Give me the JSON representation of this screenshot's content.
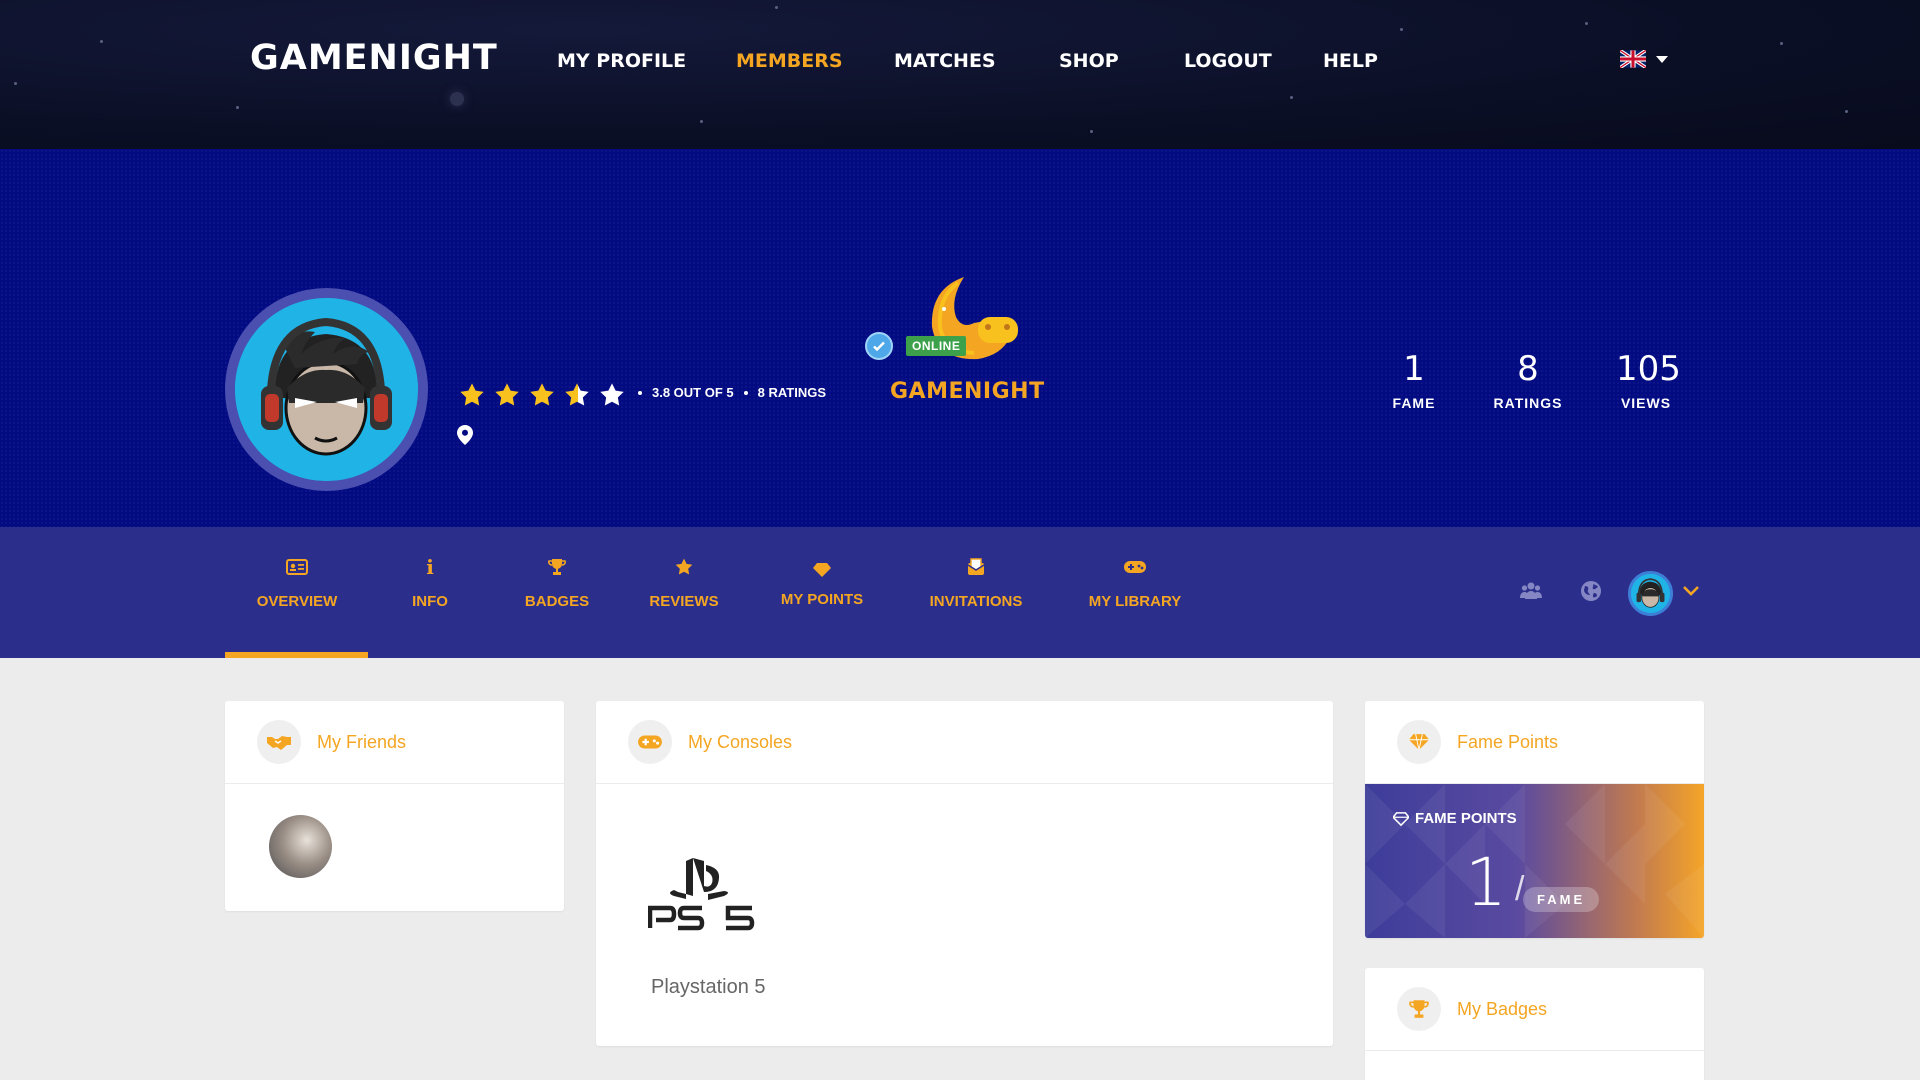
{
  "colors": {
    "accent": "#f4a622",
    "hero_bg": "#020b82",
    "tabbar_bg": "#2c2e8c",
    "online": "#3ca14a",
    "topbar_bg": "#0b0f26"
  },
  "header": {
    "logo": "GAMENIGHT",
    "nav": [
      {
        "label": "MY PROFILE",
        "active": false
      },
      {
        "label": "MEMBERS",
        "active": true
      },
      {
        "label": "MATCHES",
        "active": false
      },
      {
        "label": "SHOP",
        "active": false
      },
      {
        "label": "LOGOUT",
        "active": false
      },
      {
        "label": "HELP",
        "active": false
      }
    ],
    "language_icon": "uk-flag-icon"
  },
  "profile": {
    "rating_value": 3.8,
    "rating_text": "3.8 OUT OF 5",
    "ratings_count_text": "8 RATINGS",
    "status": "ONLINE",
    "brand": "GAMENIGHT",
    "stats": [
      {
        "value": "1",
        "label": "FAME"
      },
      {
        "value": "8",
        "label": "RATINGS"
      },
      {
        "value": "105",
        "label": "VIEWS"
      }
    ]
  },
  "tabs": [
    {
      "label": "OVERVIEW",
      "icon": "id-card-icon",
      "active": true
    },
    {
      "label": "INFO",
      "icon": "info-icon",
      "active": false
    },
    {
      "label": "BADGES",
      "icon": "trophy-icon",
      "active": false
    },
    {
      "label": "REVIEWS",
      "icon": "star-icon",
      "active": false
    },
    {
      "label": "MY POINTS",
      "icon": "diamond-icon",
      "active": false
    },
    {
      "label": "INVITATIONS",
      "icon": "envelope-icon",
      "active": false
    },
    {
      "label": "MY LIBRARY",
      "icon": "gamepad-icon",
      "active": false
    }
  ],
  "cards": {
    "friends": {
      "title": "My Friends",
      "icon": "handshake-icon"
    },
    "consoles": {
      "title": "My Consoles",
      "icon": "gamepad-icon",
      "items": [
        {
          "logo": "PS5",
          "name": "Playstation 5"
        }
      ]
    },
    "fame": {
      "title": "Fame Points",
      "icon": "diamond-icon",
      "banner_label": "FAME POINTS",
      "value": "1",
      "unit": "FAME"
    },
    "badges": {
      "title": "My Badges",
      "icon": "trophy-icon"
    }
  }
}
